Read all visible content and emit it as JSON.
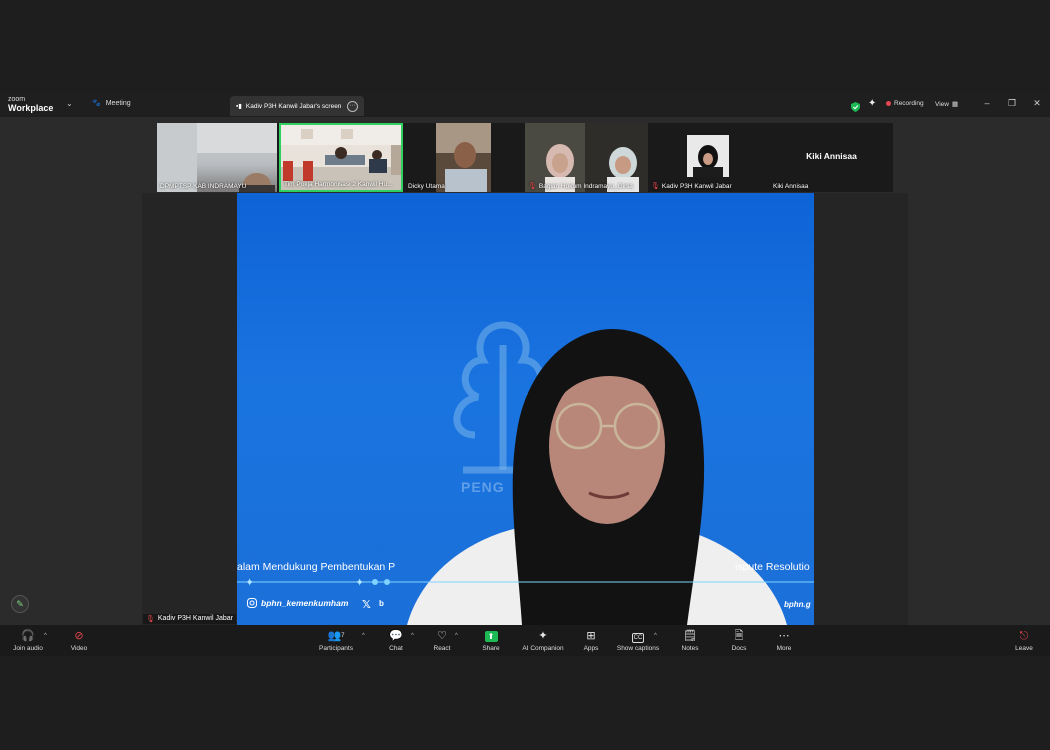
{
  "titlebar": {
    "logo_small": "zoom",
    "logo_big": "Workplace",
    "meeting_label": "Meeting",
    "screen_tab": "Kadiv P3H Kanwil Jabar's screen",
    "recording_label": "Recording",
    "view_label": "View"
  },
  "participants_strip": [
    {
      "name": "DPMPTSP KAB INDRAMAYU",
      "muted": false
    },
    {
      "name": "Tim Pokja Harmonisasi 2 Kanwil Hu...",
      "muted": false
    },
    {
      "name": "Dicky Utama",
      "muted": false
    },
    {
      "name": "Bagian Hukum Indramayu_Ginia",
      "muted": true
    },
    {
      "name": "Kadiv P3H Kanwil Jabar",
      "muted": true
    },
    {
      "name": "Kiki Annisaa",
      "muted": false,
      "center_label": "Kiki Annisaa"
    }
  ],
  "shared_screen": {
    "banner_left": "alam Mendukung Pembentukan P",
    "banner_right": "ispute Resolutio",
    "watermark": "PENG",
    "instagram": "bphn_kemenkumham",
    "x_handle": "b",
    "url": "bphn.g"
  },
  "active_speaker": "Kadiv P3H Kanwil Jabar",
  "toolbar": {
    "join_audio": "Join audio",
    "video": "Video",
    "participants": "Participants",
    "participants_count": "7",
    "chat": "Chat",
    "react": "React",
    "share": "Share",
    "ai_companion": "AI Companion",
    "apps": "Apps",
    "show_captions": "Show captions",
    "notes": "Notes",
    "docs": "Docs",
    "more": "More",
    "leave": "Leave"
  },
  "colors": {
    "share_bg": "#1a6fdc",
    "accent_green": "#1db954",
    "record_red": "#e5484d"
  }
}
